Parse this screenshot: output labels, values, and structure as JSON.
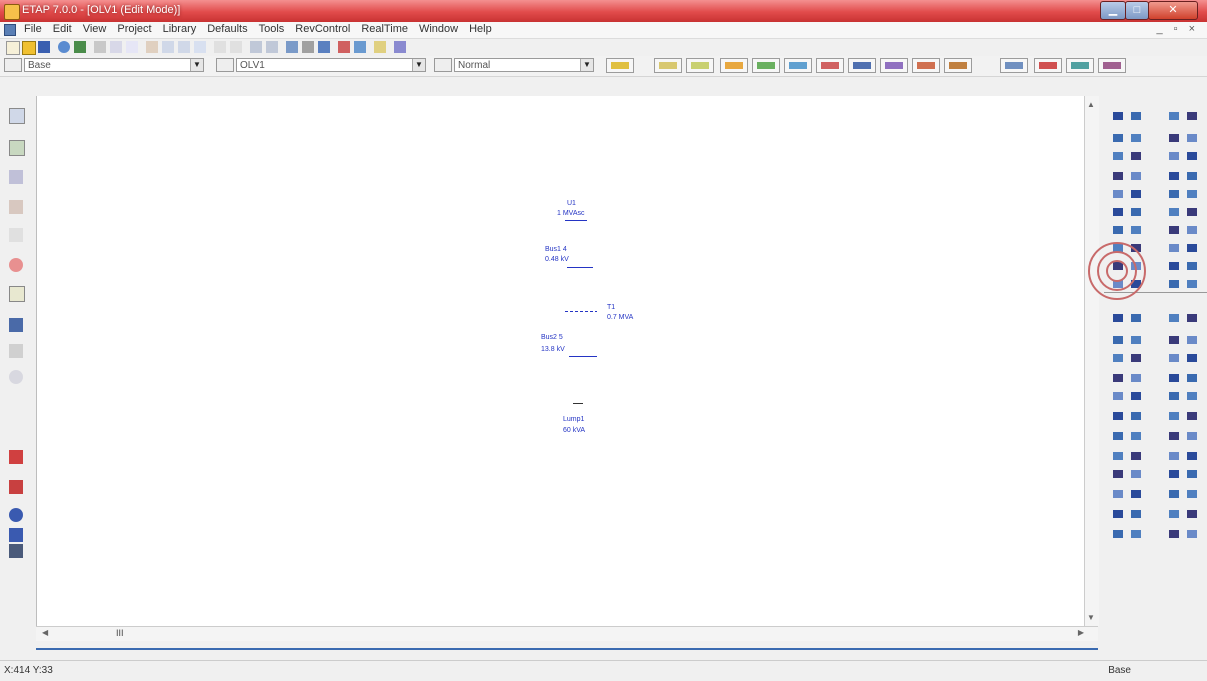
{
  "window": {
    "title": "ETAP 7.0.0 - [OLV1 (Edit Mode)]",
    "controls": {
      "minimize": "▁",
      "maximize": "□",
      "close": "✕"
    }
  },
  "menu": {
    "items": [
      "File",
      "Edit",
      "View",
      "Project",
      "Library",
      "Defaults",
      "Tools",
      "RevControl",
      "RealTime",
      "Window",
      "Help"
    ],
    "mdi_controls": "_ ▫ ×"
  },
  "toolbar2": {
    "presentation_combo": "Base",
    "config_combo": "OLV1",
    "revision_combo": "Normal"
  },
  "canvas": {
    "labels": {
      "util_id": "U1",
      "util_rating": "1 MVAsc",
      "bus1": "Bus1 4",
      "bus1_kv": "0.48 kV",
      "tx_id": "T1",
      "tx_rating": "0.7 MVA",
      "bus2": "Bus2 5",
      "bus2_kv": "13.8 kV",
      "load_id": "Lump1",
      "load_rating": "60 kVA"
    }
  },
  "scrollbar": {
    "hthumb": "III"
  },
  "status": {
    "coords": "X:414   Y:33",
    "mode": "Base"
  },
  "colors": {
    "titlebar": "#e14b4b",
    "element_blue": "#2434c4",
    "canvas_bg": "#ffffff",
    "overlay_ring": "#c86a6a"
  }
}
